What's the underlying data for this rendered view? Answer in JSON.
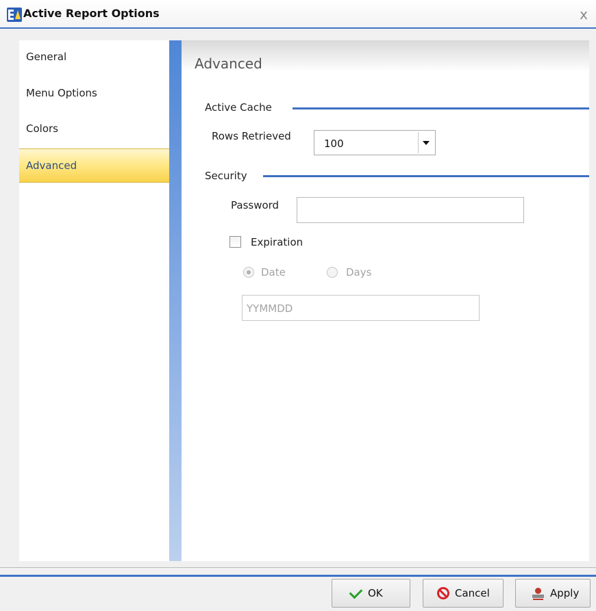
{
  "window": {
    "title": "Active Report Options",
    "close_symbol": "x"
  },
  "nav": {
    "items": [
      {
        "label": "General",
        "selected": false
      },
      {
        "label": "Menu Options",
        "selected": false
      },
      {
        "label": "Colors",
        "selected": false
      },
      {
        "label": "Advanced",
        "selected": true
      }
    ]
  },
  "content": {
    "title": "Advanced",
    "active_cache": {
      "section_label": "Active Cache",
      "rows_label": "Rows Retrieved",
      "rows_value": "100"
    },
    "security": {
      "section_label": "Security",
      "password_label": "Password",
      "password_value": "",
      "expiration_label": "Expiration",
      "expiration_checked": false,
      "radio_date_label": "Date",
      "radio_days_label": "Days",
      "selected_radio": "Date",
      "date_placeholder": "YYMMDD"
    }
  },
  "footer": {
    "ok_label": "OK",
    "cancel_label": "Cancel",
    "apply_label": "Apply"
  },
  "colors": {
    "accent_blue": "#3d73c6",
    "selected_nav_bg": "#ffe98a"
  },
  "icons": {
    "app": "app-logo-icon",
    "close": "close-icon",
    "ok": "checkmark-icon",
    "cancel": "no-entry-icon",
    "apply": "stamp-icon",
    "dropdown": "chevron-down-icon"
  }
}
